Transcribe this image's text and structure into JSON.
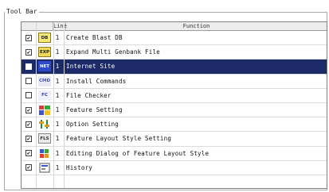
{
  "group_title": "Tool Bar",
  "header": {
    "line": "Line",
    "function": "Function"
  },
  "rows": [
    {
      "checked": true,
      "icon": "db-icon",
      "icon_text": "DB",
      "line": "1",
      "name": "Create Blast DB"
    },
    {
      "checked": true,
      "icon": "exp-icon",
      "icon_text": "EXP",
      "line": "1",
      "name": "Expand Multi Genbank File"
    },
    {
      "checked": false,
      "icon": "net-icon",
      "icon_text": "NET",
      "line": "1",
      "name": "Internet Site",
      "selected": true
    },
    {
      "checked": false,
      "icon": "cmd-icon",
      "icon_text": "CMD",
      "line": "1",
      "name": "Install Commands"
    },
    {
      "checked": false,
      "icon": "fc-icon",
      "icon_text": "FC",
      "line": "1",
      "name": "File Checker"
    },
    {
      "checked": true,
      "icon": "feature-icon",
      "icon_text": "",
      "line": "1",
      "name": "Feature Setting"
    },
    {
      "checked": true,
      "icon": "option-icon",
      "icon_text": "",
      "line": "1",
      "name": "Option Setting"
    },
    {
      "checked": true,
      "icon": "fls-icon",
      "icon_text": "FLS",
      "line": "1",
      "name": "Feature Layout Style Setting"
    },
    {
      "checked": true,
      "icon": "edit-dialog-icon",
      "icon_text": "",
      "line": "1",
      "name": "Editing Dialog of Feature Layout Style"
    },
    {
      "checked": true,
      "icon": "history-icon",
      "icon_text": "",
      "line": "1",
      "name": "History"
    }
  ]
}
